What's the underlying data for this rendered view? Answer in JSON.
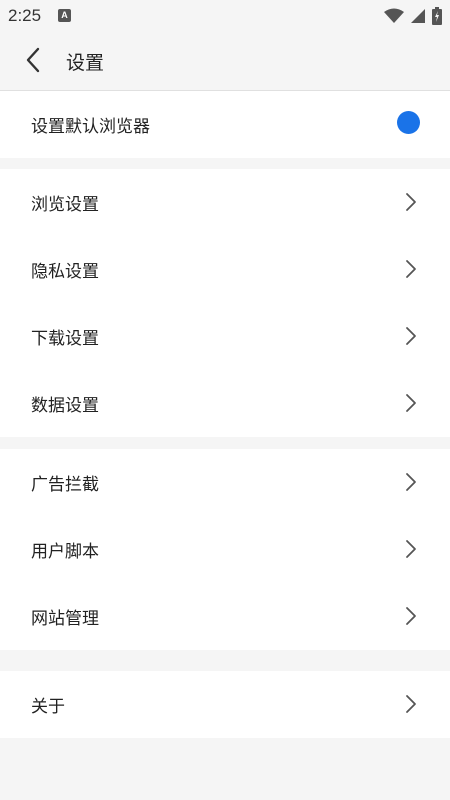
{
  "status_bar": {
    "time": "2:25",
    "app_icon_letter": "A"
  },
  "header": {
    "title": "设置"
  },
  "default_browser": {
    "label": "设置默认浏览器",
    "toggle_color": "#1a73e8"
  },
  "group1": [
    {
      "label": "浏览设置"
    },
    {
      "label": "隐私设置"
    },
    {
      "label": "下载设置"
    },
    {
      "label": "数据设置"
    }
  ],
  "group2": [
    {
      "label": "广告拦截"
    },
    {
      "label": "用户脚本"
    },
    {
      "label": "网站管理"
    }
  ],
  "group3": [
    {
      "label": "关于"
    }
  ],
  "colors": {
    "background": "#f5f5f5",
    "card": "#ffffff",
    "accent": "#1a73e8"
  }
}
